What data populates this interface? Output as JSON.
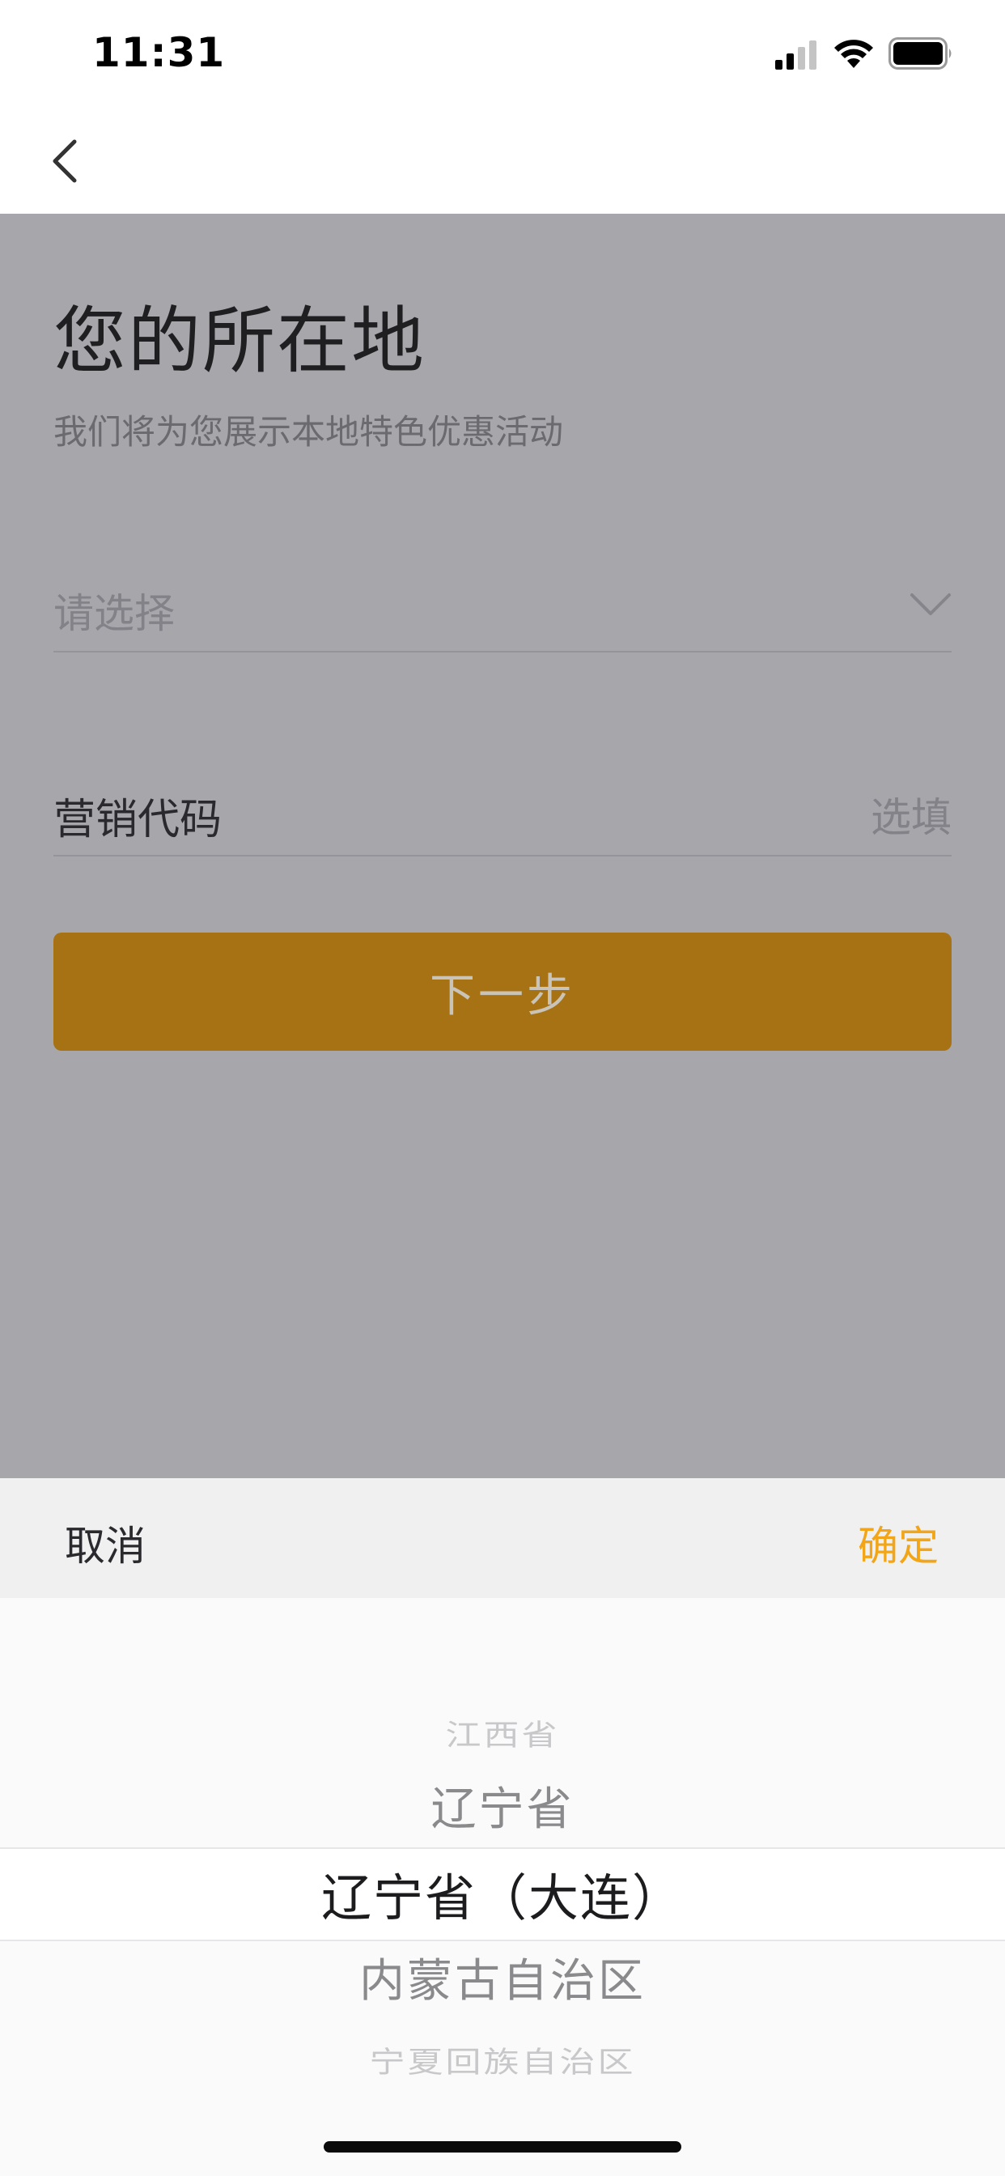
{
  "status_bar": {
    "time": "11:31"
  },
  "nav": {
    "back_icon": "chevron-left-icon"
  },
  "page": {
    "title": "您的所在地",
    "subtitle": "我们将为您展示本地特色优惠活动"
  },
  "form": {
    "region_placeholder": "请选择",
    "marketing_label": "营销代码",
    "marketing_placeholder": "选填",
    "next_button": "下一步"
  },
  "picker": {
    "cancel_label": "取消",
    "confirm_label": "确定",
    "options": [
      "江西省",
      "辽宁省",
      "辽宁省（大连）",
      "内蒙古自治区",
      "宁夏回族自治区"
    ],
    "selected_index": 2
  },
  "colors": {
    "accent": "#f2a516",
    "button": "#a67214",
    "overlay_bg": "#a7a6ab"
  }
}
